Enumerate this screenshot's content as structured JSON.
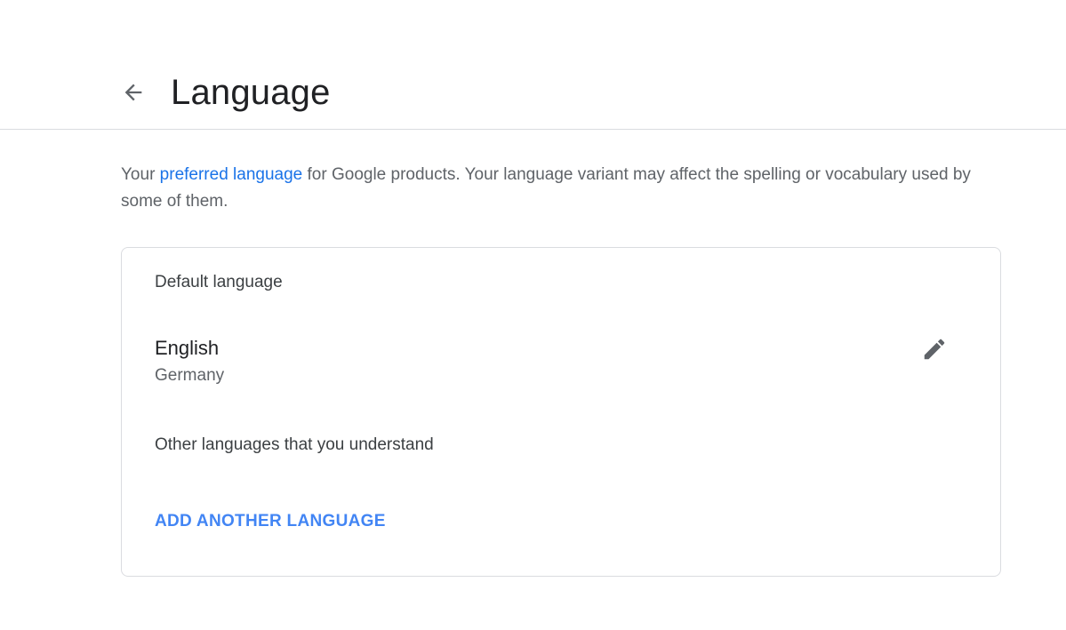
{
  "header": {
    "title": "Language",
    "back_icon": "arrow-back-icon"
  },
  "intro": {
    "prefix": "Your ",
    "link_text": "preferred language",
    "suffix": " for Google products. Your language variant may affect the spelling or vocabulary used by some of them."
  },
  "card": {
    "default_heading": "Default language",
    "default_language": {
      "name": "English",
      "region": "Germany",
      "edit_icon": "pencil-icon"
    },
    "other_heading": "Other languages that you understand",
    "add_button_label": "ADD ANOTHER LANGUAGE"
  },
  "colors": {
    "link": "#1a73e8",
    "accent_button": "#4285f4",
    "divider": "#dadce0",
    "secondary_text": "#5f6368"
  }
}
